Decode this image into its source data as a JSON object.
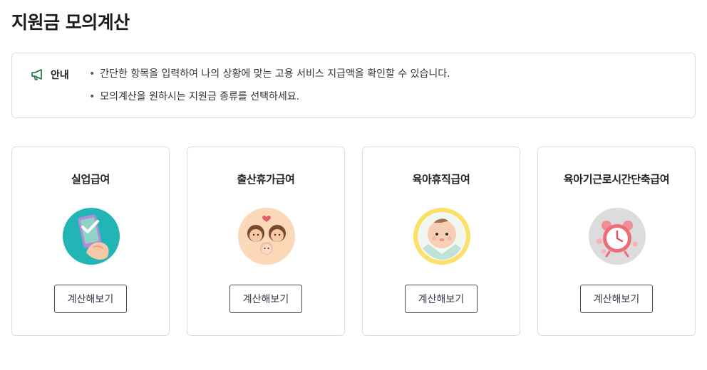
{
  "page": {
    "title": "지원금 모의계산"
  },
  "notice": {
    "label": "안내",
    "icon": "megaphone-icon",
    "icon_color": "#2e7d4f",
    "items": [
      "간단한 항목을 입력하여 나의 상황에 맞는 고용 서비스 지급액을 확인할 수 있습니다.",
      "모의계산을 원하시는 지원금 종류를 선택하세요."
    ]
  },
  "cards": [
    {
      "title": "실업급여",
      "button_label": "계산해보기",
      "icon": "phone-checkmark-icon"
    },
    {
      "title": "출산휴가급여",
      "button_label": "계산해보기",
      "icon": "family-baby-icon"
    },
    {
      "title": "육아휴직급여",
      "button_label": "계산해보기",
      "icon": "baby-face-icon"
    },
    {
      "title": "육아기근로시간단축급여",
      "button_label": "계산해보기",
      "icon": "alarm-clock-icon"
    }
  ]
}
